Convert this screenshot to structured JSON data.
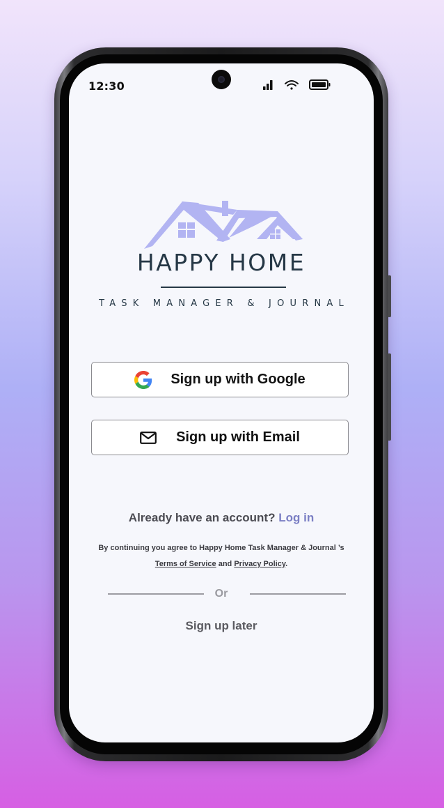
{
  "status_bar": {
    "time": "12:30"
  },
  "brand": {
    "name": "HAPPY HOME",
    "tagline": "TASK MANAGER & JOURNAL",
    "colors": {
      "roof": "#b2b4f2",
      "text": "#263846"
    }
  },
  "auth": {
    "google_label": "Sign up with Google",
    "email_label": "Sign up with Email"
  },
  "login": {
    "prompt": "Already have an account?",
    "link": "Log in",
    "link_color": "#7b7fc4"
  },
  "terms": {
    "prefix": "By continuing you agree to Happy Home Task Manager & Journal ’s",
    "tos_link": "Terms of Service",
    "and": "and",
    "privacy_link": "Privacy Policy",
    "suffix": "."
  },
  "divider_text": "Or",
  "later_label": "Sign up later",
  "icons": [
    "signal-icon",
    "wifi-icon",
    "battery-icon",
    "google-icon",
    "mail-icon",
    "house-logo-icon"
  ]
}
